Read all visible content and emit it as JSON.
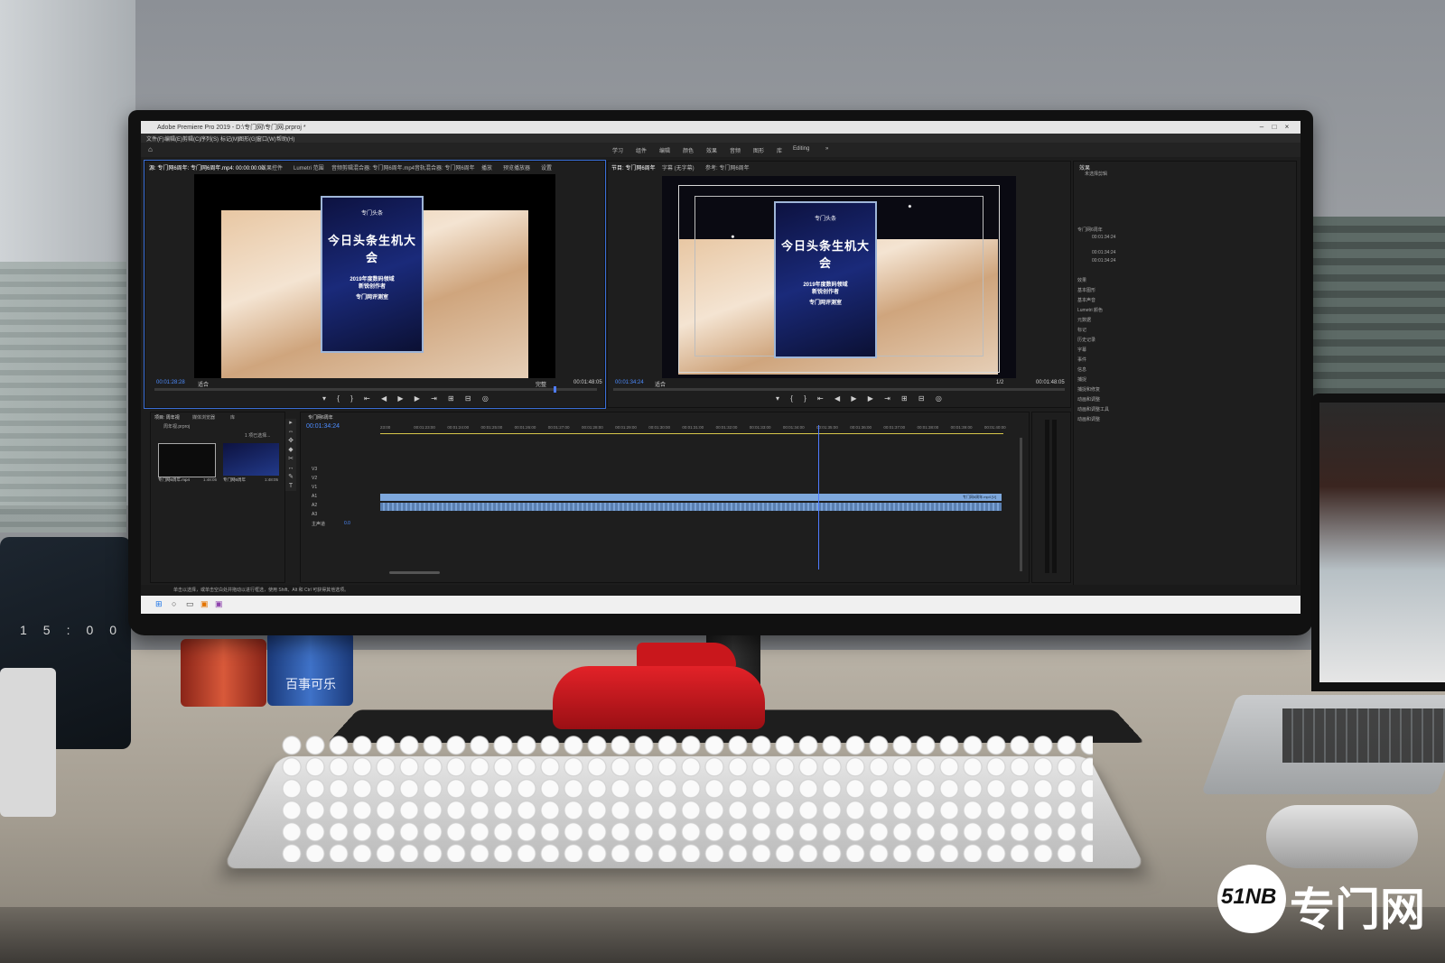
{
  "app": {
    "window_title": "Adobe Premiere Pro 2019 - D:\\专门网\\专门网.prproj *",
    "menus": [
      "文件(F)",
      "编辑(E)",
      "剪辑(C)",
      "序列(S)",
      "标记(M)",
      "图形(G)",
      "窗口(W)",
      "帮助(H)"
    ],
    "workspaces": [
      "学习",
      "组件",
      "编辑",
      "颜色",
      "效果",
      "音频",
      "图形",
      "库",
      "Editing",
      "»"
    ]
  },
  "source_monitor": {
    "tabs": [
      "源: 专门网6周年: 专门网6周年.mp4: 00:00:00:00",
      "效果控件",
      "Lumetri 范围",
      "音频剪辑混合器: 专门网6周年.mp4",
      "音轨混合器: 专门网6周年",
      "播放",
      "预览播放器",
      "设置"
    ],
    "timecode_left": "00:01:28:28",
    "fit": "适合",
    "quality": "完整",
    "timecode_right": "00:01:48:05"
  },
  "program_monitor": {
    "tabs": [
      "节目: 专门网6周年",
      "字幕 (无字幕)",
      "参考: 专门网6周年"
    ],
    "timecode_left": "00:01:34:24",
    "fit": "适合",
    "quality": "1/2",
    "timecode_right": "00:01:48:05"
  },
  "award": {
    "logo": "专门头条",
    "title": "今日头条生机大会",
    "subtitle_line1": "2019年度数码领域",
    "subtitle_line2": "新锐创作者",
    "subtitle_line3": "专门网评测室"
  },
  "project_panel": {
    "tabs": [
      "项目: 周年视",
      "媒体浏览器",
      "库"
    ],
    "project_file": "周年视.prproj",
    "selection": "1 项已选择...",
    "items": [
      {
        "name": "专门网6周年.mp4",
        "duration": "1:48:05"
      },
      {
        "name": "专门网6周年",
        "duration": "1:48:05"
      }
    ]
  },
  "timeline": {
    "tab": "专门网6周年",
    "timecode": "00:01:34:24",
    "ruler": [
      "23:00",
      "00:01:23:00",
      "00:01:24:00",
      "00:01:25:00",
      "00:01:26:00",
      "00:01:27:00",
      "00:01:28:00",
      "00:01:29:00",
      "00:01:30:00",
      "00:01:31:00",
      "00:01:32:00",
      "00:01:33:00",
      "00:01:34:00",
      "00:01:35:00",
      "00:01:36:00",
      "00:01:37:00",
      "00:01:38:00",
      "00:01:39:00",
      "00:01:40:00"
    ],
    "tracks": [
      "V3",
      "V2",
      "V1",
      "A1",
      "A2",
      "A3",
      "主声道"
    ],
    "master_value": "0.0",
    "clip_label": "专门网6周年.mp4 [V]"
  },
  "effects_panel": {
    "title": "效果",
    "subtitle": "未选择剪辑",
    "clip_name": "专门网6周年",
    "meta": [
      "00:01:34:24",
      "00:01:34:24",
      "00:01:34:24"
    ],
    "list": [
      "效果",
      "基本图形",
      "基本声音",
      "Lumetri 颜色",
      "元数据",
      "标记",
      "历史记录",
      "字幕",
      "事件",
      "信息",
      "捕捉",
      "捕捉和修复",
      "动画和调整",
      "动画和调整工具",
      "动画和调整"
    ]
  },
  "status_bar": {
    "text": "单击以选择，或单击空白处并拖动以进行框选，使用 Shift、Alt 和 Ctrl 可获得其他选项。"
  },
  "phone": {
    "clock": "15:00"
  },
  "can": {
    "brand": "百事可乐"
  },
  "watermark": {
    "mark": "51NB",
    "text": "专门网"
  },
  "colors": {
    "accent": "#3b6fd8",
    "timecode": "#4d8cff",
    "clip": "#7ea8dd",
    "playhead": "#4f7cff"
  }
}
